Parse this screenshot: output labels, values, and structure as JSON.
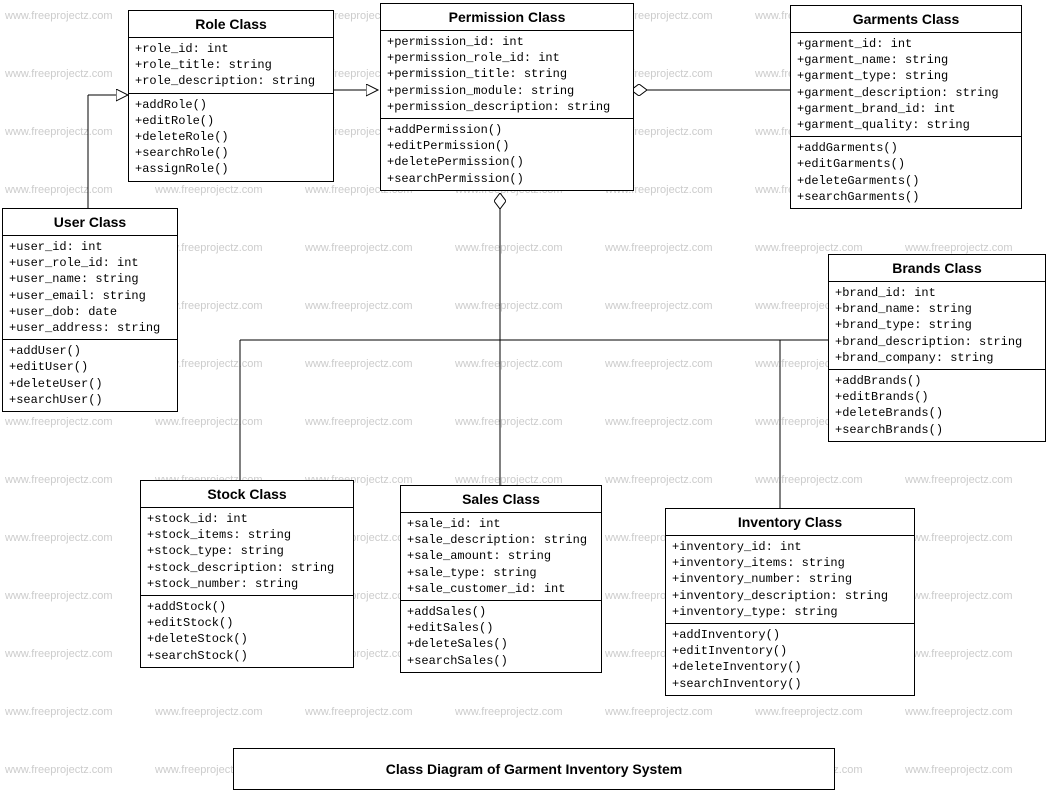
{
  "caption": "Class Diagram of Garment Inventory System",
  "watermark_text": "www.freeprojectz.com",
  "classes": {
    "role": {
      "title": "Role Class",
      "attrs": [
        "+role_id: int",
        "+role_title: string",
        "+role_description: string"
      ],
      "methods": [
        "+addRole()",
        "+editRole()",
        "+deleteRole()",
        "+searchRole()",
        "+assignRole()"
      ]
    },
    "permission": {
      "title": "Permission Class",
      "attrs": [
        "+permission_id: int",
        "+permission_role_id: int",
        "+permission_title: string",
        "+permission_module: string",
        "+permission_description: string"
      ],
      "methods": [
        "+addPermission()",
        "+editPermission()",
        "+deletePermission()",
        "+searchPermission()"
      ]
    },
    "garments": {
      "title": "Garments Class",
      "attrs": [
        "+garment_id: int",
        "+garment_name: string",
        "+garment_type: string",
        "+garment_description: string",
        "+garment_brand_id: int",
        "+garment_quality: string"
      ],
      "methods": [
        "+addGarments()",
        "+editGarments()",
        "+deleteGarments()",
        "+searchGarments()"
      ]
    },
    "user": {
      "title": "User Class",
      "attrs": [
        "+user_id: int",
        "+user_role_id: int",
        "+user_name: string",
        "+user_email: string",
        "+user_dob: date",
        "+user_address: string"
      ],
      "methods": [
        "+addUser()",
        "+editUser()",
        "+deleteUser()",
        "+searchUser()"
      ]
    },
    "brands": {
      "title": "Brands Class",
      "attrs": [
        "+brand_id: int",
        "+brand_name: string",
        "+brand_type: string",
        "+brand_description: string",
        "+brand_company: string"
      ],
      "methods": [
        "+addBrands()",
        "+editBrands()",
        "+deleteBrands()",
        "+searchBrands()"
      ]
    },
    "stock": {
      "title": "Stock Class",
      "attrs": [
        "+stock_id: int",
        "+stock_items: string",
        "+stock_type: string",
        "+stock_description: string",
        "+stock_number: string"
      ],
      "methods": [
        "+addStock()",
        "+editStock()",
        "+deleteStock()",
        "+searchStock()"
      ]
    },
    "sales": {
      "title": "Sales Class",
      "attrs": [
        "+sale_id: int",
        "+sale_description: string",
        "+sale_amount: string",
        "+sale_type: string",
        "+sale_customer_id: int"
      ],
      "methods": [
        "+addSales()",
        "+editSales()",
        "+deleteSales()",
        "+searchSales()"
      ]
    },
    "inventory": {
      "title": "Inventory Class",
      "attrs": [
        "+inventory_id: int",
        "+inventory_items: string",
        "+inventory_number: string",
        "+inventory_description: string",
        "+inventory_type: string"
      ],
      "methods": [
        "+addInventory()",
        "+editInventory()",
        "+deleteInventory()",
        "+searchInventory()"
      ]
    }
  }
}
